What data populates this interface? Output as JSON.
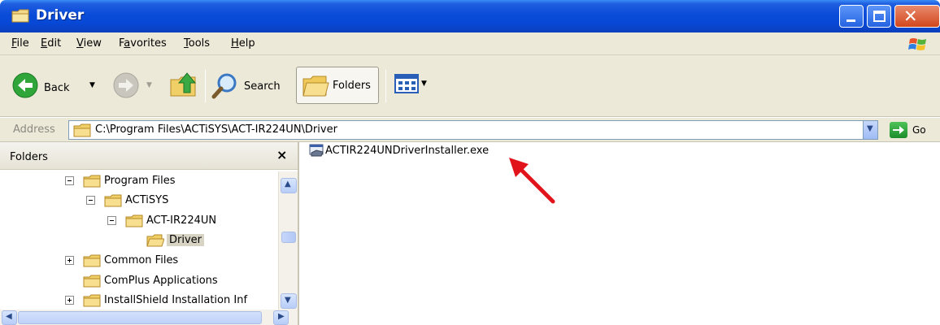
{
  "window": {
    "title": "Driver"
  },
  "menu": {
    "items": [
      {
        "mnemonic": "F",
        "rest": "ile"
      },
      {
        "mnemonic": "E",
        "rest": "dit"
      },
      {
        "mnemonic": "V",
        "rest": "iew"
      },
      {
        "pre": "F",
        "mnemonic": "a",
        "rest": "vorites"
      },
      {
        "mnemonic": "T",
        "rest": "ools"
      },
      {
        "mnemonic": "H",
        "rest": "elp"
      }
    ]
  },
  "toolbar": {
    "back_label": "Back",
    "search_label": "Search",
    "folders_label": "Folders"
  },
  "address": {
    "label": "Address",
    "value": "C:\\Program Files\\ACTiSYS\\ACT-IR224UN\\Driver",
    "go_label": "Go"
  },
  "folders_pane": {
    "title": "Folders",
    "close_glyph": "×",
    "tree": [
      {
        "label": "Program Files",
        "expander": "minus"
      },
      {
        "label": "ACTiSYS",
        "expander": "minus"
      },
      {
        "label": "ACT-IR224UN",
        "expander": "minus"
      },
      {
        "label": "Driver",
        "expander": "none",
        "selected": true
      },
      {
        "label": "Common Files",
        "expander": "plus"
      },
      {
        "label": "ComPlus Applications",
        "expander": "none"
      },
      {
        "label": "InstallShield Installation Inf",
        "expander": "plus"
      }
    ]
  },
  "files": [
    {
      "name": "ACTIR224UNDriverInstaller.exe",
      "icon": "installer-exe-icon"
    }
  ],
  "colors": {
    "titlebar": "#0848d6",
    "chrome": "#ece9d8",
    "annotation_arrow": "#e0141a"
  }
}
